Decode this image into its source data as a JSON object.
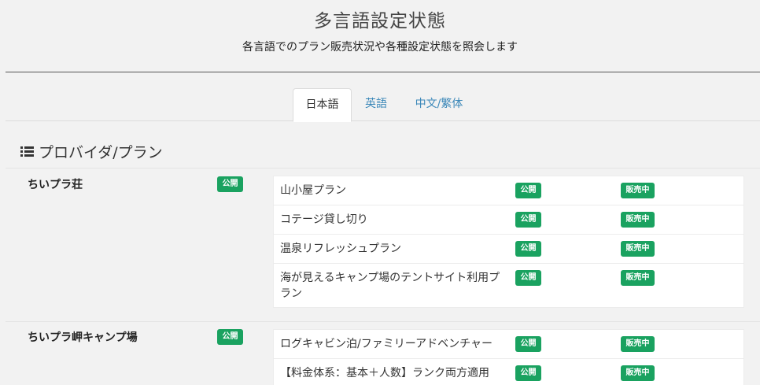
{
  "header": {
    "title": "多言語設定状態",
    "subtitle": "各言語でのプラン販売状況や各種設定状態を照会します"
  },
  "tabs": [
    {
      "label": "日本語",
      "active": true
    },
    {
      "label": "英語",
      "active": false
    },
    {
      "label": "中文/繁体",
      "active": false
    }
  ],
  "section": {
    "title": "プロバイダ/プラン",
    "icon": "list-icon"
  },
  "providers": [
    {
      "name": "ちいプラ荘",
      "status": "公開",
      "plans": [
        {
          "name": "山小屋プラン",
          "status": "公開",
          "sales": "販売中"
        },
        {
          "name": "コテージ貸し切り",
          "status": "公開",
          "sales": "販売中"
        },
        {
          "name": "温泉リフレッシュプラン",
          "status": "公開",
          "sales": "販売中"
        },
        {
          "name": "海が見えるキャンプ場のテントサイト利用プラン",
          "status": "公開",
          "sales": "販売中"
        }
      ]
    },
    {
      "name": "ちいプラ岬キャンプ場",
      "status": "公開",
      "plans": [
        {
          "name": "ログキャビン泊/ファミリーアドベンチャー",
          "status": "公開",
          "sales": "販売中"
        },
        {
          "name": "【料金体系：基本＋人数】ランク両方適用",
          "status": "公開",
          "sales": "販売中"
        }
      ]
    }
  ],
  "colors": {
    "badge": "#1aa260",
    "tab_link": "#3a87b8",
    "background": "#f2f2f2"
  }
}
